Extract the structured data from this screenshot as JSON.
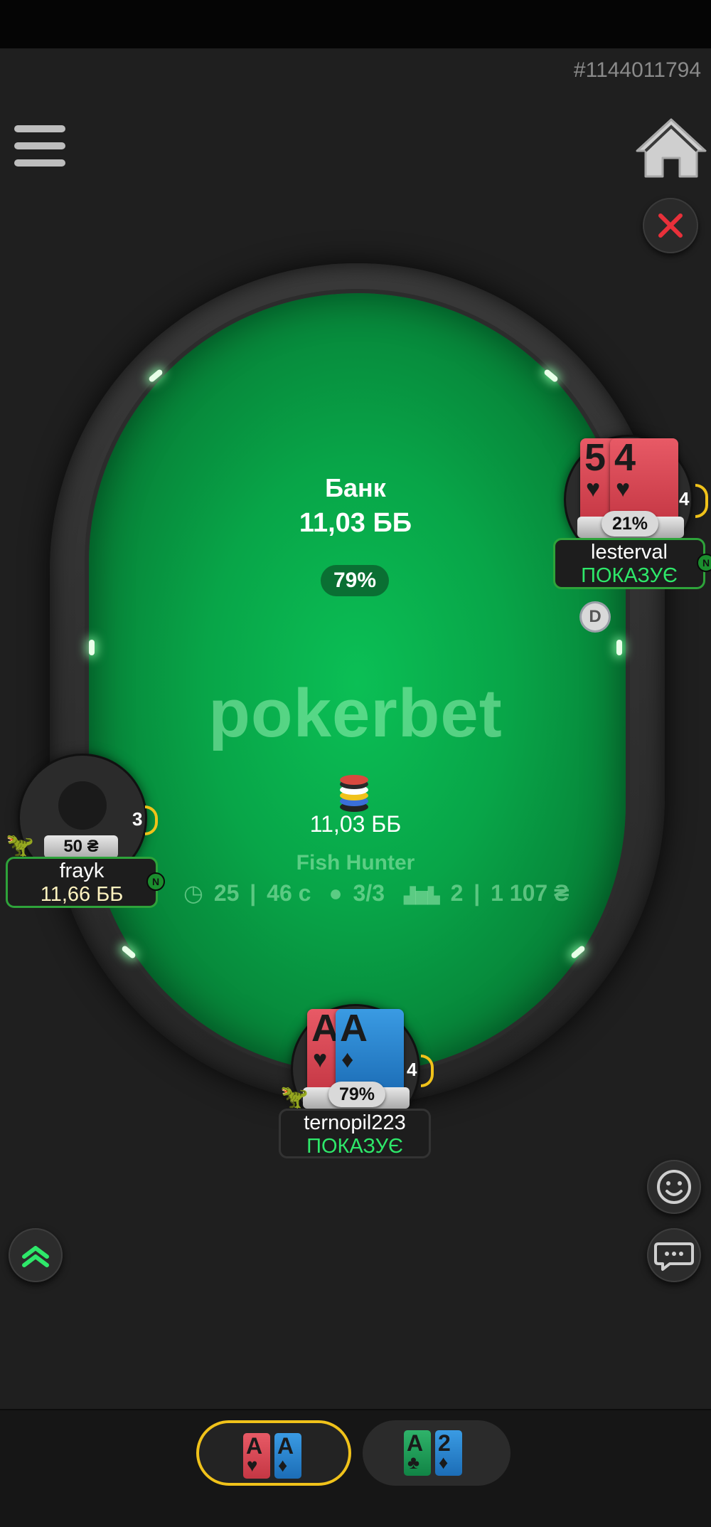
{
  "hand_id": "#1144011794",
  "table": {
    "pot_label": "Банк",
    "pot_amount": "11,03 ББ",
    "pot_equity": "79%",
    "brand": "pokerbet",
    "center_bet": "11,03 ББ",
    "name": "Fish Hunter",
    "info": {
      "blind_level": "25",
      "time": "46 с",
      "players": "3/3",
      "place": "2",
      "prize": "1 107 ₴"
    },
    "dealer_label": "D"
  },
  "seats": {
    "right": {
      "name": "lesterval",
      "status": "ПОКАЗУЄ",
      "equity": "21%",
      "timer": "4",
      "badge": "N",
      "cards": [
        {
          "rank": "5",
          "suit": "♥"
        },
        {
          "rank": "4",
          "suit": "♥"
        }
      ]
    },
    "left": {
      "name": "frayk",
      "stack": "11,66 ББ",
      "bet": "50 ₴",
      "timer": "3",
      "badge": "N"
    },
    "hero": {
      "name": "ternopil223",
      "status": "ПОКАЗУЄ",
      "equity": "79%",
      "timer": "4",
      "cards": [
        {
          "rank": "A",
          "suit": "♥"
        },
        {
          "rank": "A",
          "suit": "♦"
        }
      ]
    }
  },
  "bottom_tabs": [
    {
      "cards": [
        {
          "rank": "A",
          "suit": "♥"
        },
        {
          "rank": "A",
          "suit": "♦"
        }
      ],
      "active": true
    },
    {
      "cards": [
        {
          "rank": "A",
          "suit": "♣"
        },
        {
          "rank": "2",
          "suit": "♦"
        }
      ],
      "active": false
    }
  ],
  "colors": {
    "felt": "#08a548",
    "accent_green": "#2ee86a",
    "active_tab_border": "#f0c21a",
    "close_red": "#e8303a"
  }
}
